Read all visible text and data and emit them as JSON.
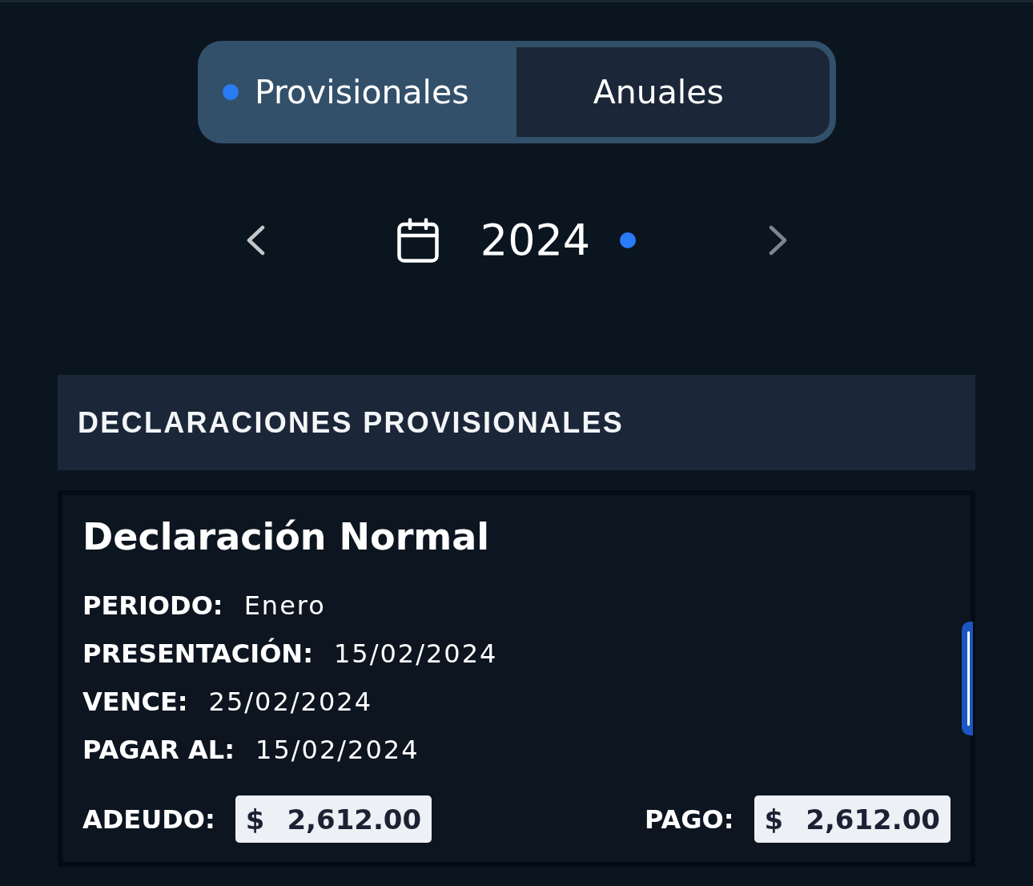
{
  "tabs": [
    {
      "label": "Provisionales",
      "selected": true
    },
    {
      "label": "Anuales",
      "selected": false
    }
  ],
  "year_nav": {
    "year": "2024",
    "current": true,
    "previous": {
      "disabled": false
    },
    "next": {
      "disabled": true
    }
  },
  "section": {
    "title": "DECLARACIONES PROVISIONALES"
  },
  "declarations": [
    {
      "title": "Declaración Normal",
      "fields": [
        {
          "label": "PERIODO:",
          "value": "Enero"
        },
        {
          "label": "PRESENTACIÓN:",
          "value": "15/02/2024"
        },
        {
          "label": "VENCE:",
          "value": "25/02/2024"
        },
        {
          "label": "PAGAR AL:",
          "value": "15/02/2024"
        }
      ],
      "amounts": [
        {
          "label": "ADEUDO:",
          "currency": "$",
          "value": "2,612.00"
        },
        {
          "label": "PAGO:",
          "currency": "$",
          "value": "2,612.00"
        }
      ]
    }
  ]
}
